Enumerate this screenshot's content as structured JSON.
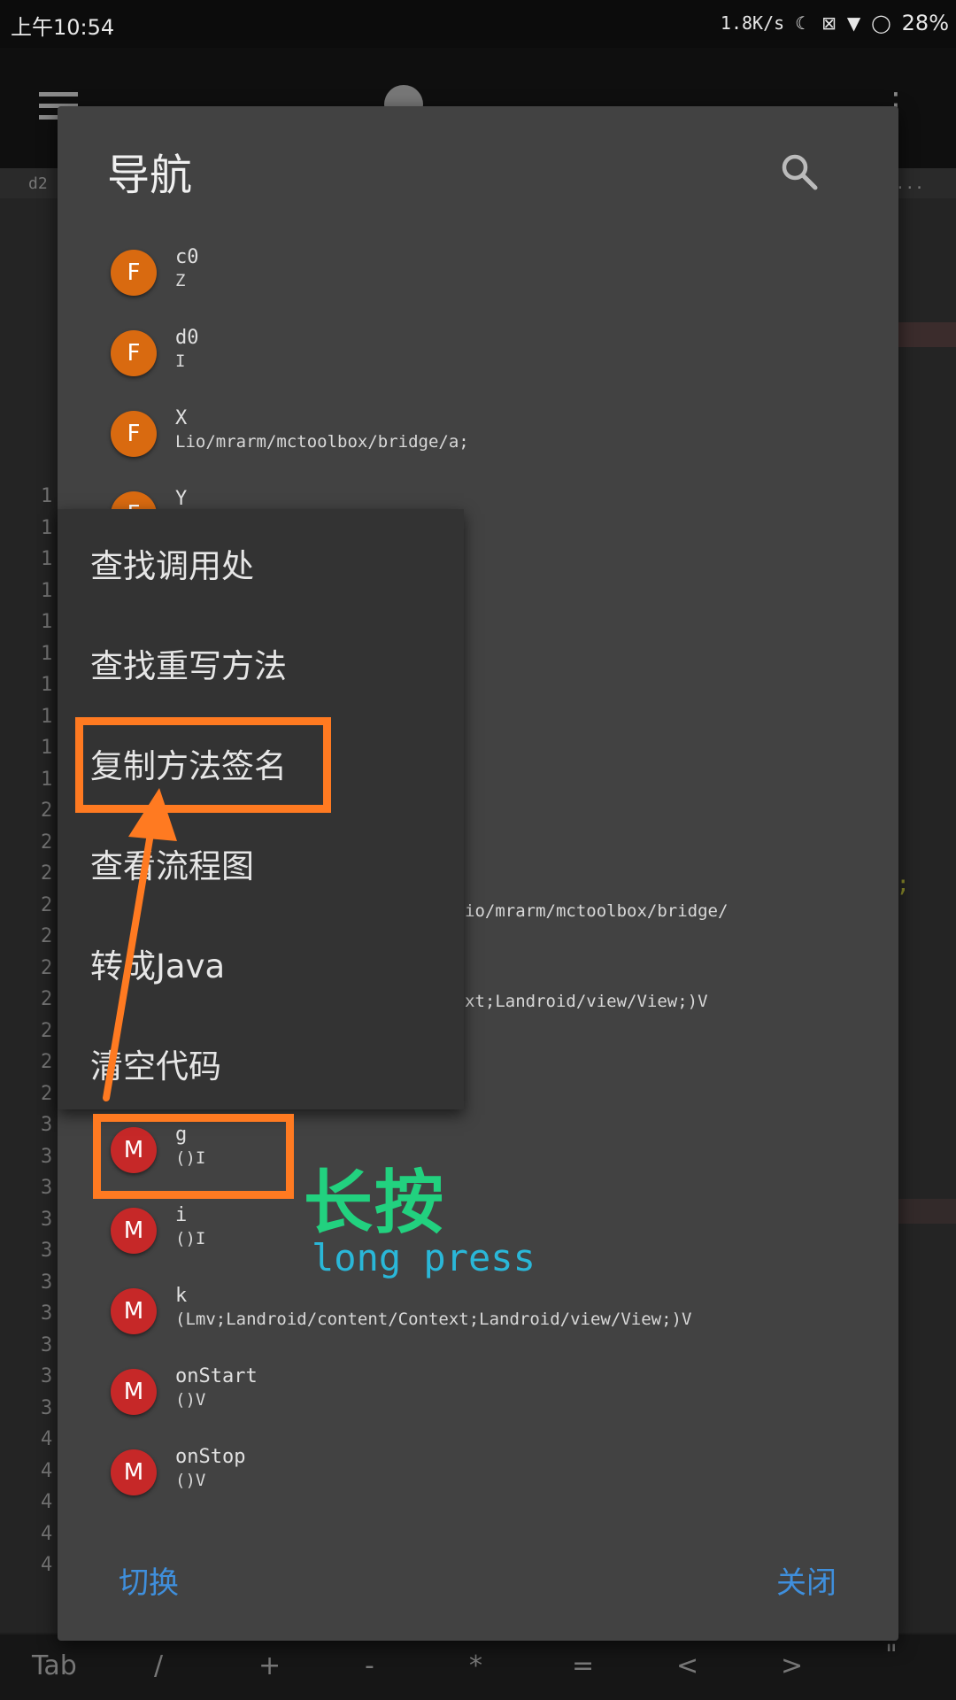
{
  "status_bar": {
    "time": "上午10:54",
    "speed": "1.8K/s",
    "battery": "28%"
  },
  "tab_strip": {
    "left": "d2",
    "right": "..."
  },
  "editor": {
    "line_numbers": [
      "1",
      "1",
      "1",
      "1",
      "1",
      "1",
      "1",
      "1",
      "1",
      "1",
      "2",
      "2",
      "2",
      "2",
      "2",
      "2",
      "2",
      "2",
      "2",
      "2",
      "3",
      "3",
      "3",
      "3",
      "3",
      "3",
      "3",
      "3",
      "3",
      "3",
      "4",
      "4",
      "4",
      "4",
      "4"
    ],
    "semicolon": ";"
  },
  "dialog": {
    "title": "导航",
    "items": [
      {
        "kind": "F",
        "name": "c0",
        "sig": "Z"
      },
      {
        "kind": "F",
        "name": "d0",
        "sig": "I"
      },
      {
        "kind": "F",
        "name": "X",
        "sig": "Lio/mrarm/mctoolbox/bridge/a;"
      },
      {
        "kind": "F",
        "name": "Y",
        "sig": ""
      }
    ],
    "partial_sigs": [
      "io/mrarm/mctoolbox/bridge/",
      "xt;Landroid/view/View;)V"
    ],
    "items_bottom": [
      {
        "kind": "M",
        "name": "g",
        "sig": "()I"
      },
      {
        "kind": "M",
        "name": "i",
        "sig": "()I"
      },
      {
        "kind": "M",
        "name": "k",
        "sig": "(Lmv;Landroid/content/Context;Landroid/view/View;)V"
      },
      {
        "kind": "M",
        "name": "onStart",
        "sig": "()V"
      },
      {
        "kind": "M",
        "name": "onStop",
        "sig": "()V"
      }
    ],
    "switch_label": "切换",
    "close_label": "关闭"
  },
  "context_menu": {
    "items": [
      "查找调用处",
      "查找重写方法",
      "复制方法签名",
      "查看流程图",
      "转成Java",
      "清空代码"
    ]
  },
  "annotation": {
    "chinese": "长按",
    "english": "long press",
    "color": "#ff7a21"
  },
  "keys_bar": [
    "Tab",
    "/",
    "+",
    "-",
    "*",
    "=",
    "<",
    ">",
    "\""
  ]
}
